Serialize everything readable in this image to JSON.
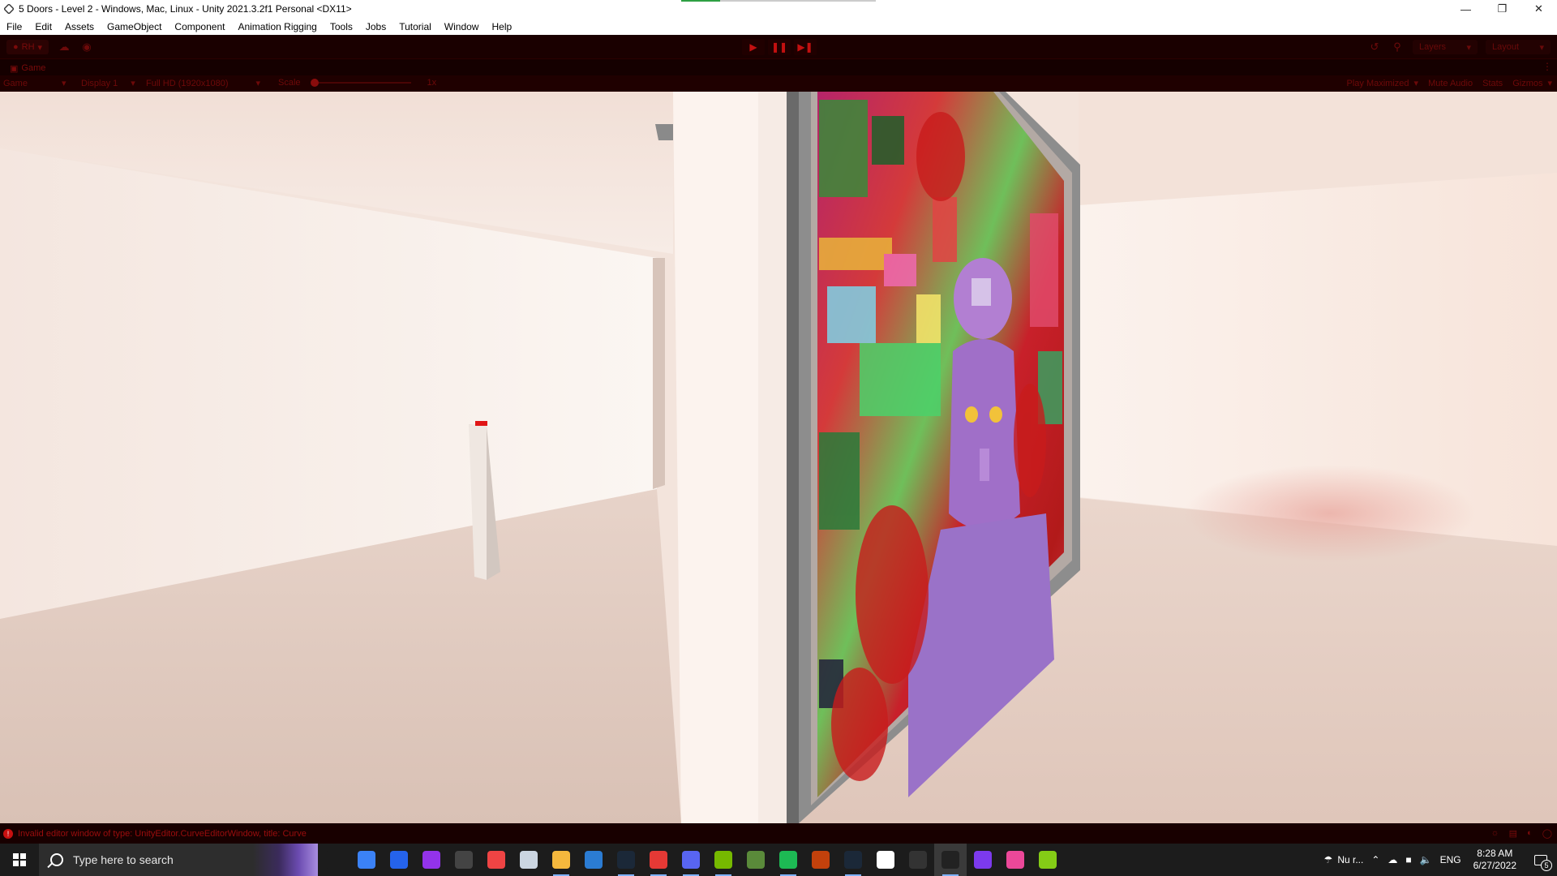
{
  "window": {
    "title": "5 Doors - Level 2 - Windows, Mac, Linux - Unity 2021.3.2f1 Personal <DX11>",
    "progress_fraction": 0.2
  },
  "menu": [
    "File",
    "Edit",
    "Assets",
    "GameObject",
    "Component",
    "Animation Rigging",
    "Tools",
    "Jobs",
    "Tutorial",
    "Window",
    "Help"
  ],
  "toolbar": {
    "account_label": "RH",
    "layers_label": "Layers",
    "layout_label": "Layout"
  },
  "game_view": {
    "tab_label": "Game",
    "mode": "Game",
    "display": "Display 1",
    "resolution": "Full HD (1920x1080)",
    "scale_label": "Scale",
    "scale_value": "1x",
    "play_maximized": "Play Maximized",
    "mute_audio": "Mute Audio",
    "stats": "Stats",
    "gizmos": "Gizmos"
  },
  "status": {
    "message": "Invalid editor window of type: UnityEditor.CurveEditorWindow, title: Curve"
  },
  "taskbar": {
    "search_placeholder": "Type here to search",
    "apps": [
      {
        "icon": "task-view-icon",
        "color": "#1c1c1c"
      },
      {
        "icon": "todo-icon",
        "color": "#3b82f6"
      },
      {
        "icon": "edge-icon",
        "color": "#2563eb"
      },
      {
        "icon": "cortana-icon",
        "color": "#9333ea"
      },
      {
        "icon": "skyrim-icon",
        "color": "#444444"
      },
      {
        "icon": "ea-icon",
        "color": "#ef4444"
      },
      {
        "icon": "explorer-alt-icon",
        "color": "#cbd5e1"
      },
      {
        "icon": "file-explorer-icon",
        "color": "#f5b83d"
      },
      {
        "icon": "mail-icon",
        "color": "#2b7cd3"
      },
      {
        "icon": "steam-icon",
        "color": "#1b2838"
      },
      {
        "icon": "chrome-icon",
        "color": "#e53935"
      },
      {
        "icon": "discord-icon",
        "color": "#5865f2"
      },
      {
        "icon": "nvidia-icon",
        "color": "#76b900"
      },
      {
        "icon": "minecraft-icon",
        "color": "#5a8a3a"
      },
      {
        "icon": "spotify-icon",
        "color": "#1db954"
      },
      {
        "icon": "game-icon",
        "color": "#c2410c"
      },
      {
        "icon": "steam2-icon",
        "color": "#1b2838"
      },
      {
        "icon": "notion-icon",
        "color": "#ffffff"
      },
      {
        "icon": "obs-icon",
        "color": "#333333"
      },
      {
        "icon": "unity-icon",
        "color": "#222222"
      },
      {
        "icon": "visual-studio-icon",
        "color": "#7c3aed"
      },
      {
        "icon": "photo-icon",
        "color": "#ec4899"
      },
      {
        "icon": "android-icon",
        "color": "#84cc16"
      }
    ],
    "weather": "Nu r...",
    "language": "ENG",
    "time": "8:28 AM",
    "date": "6/27/2022",
    "notifications": "5"
  }
}
